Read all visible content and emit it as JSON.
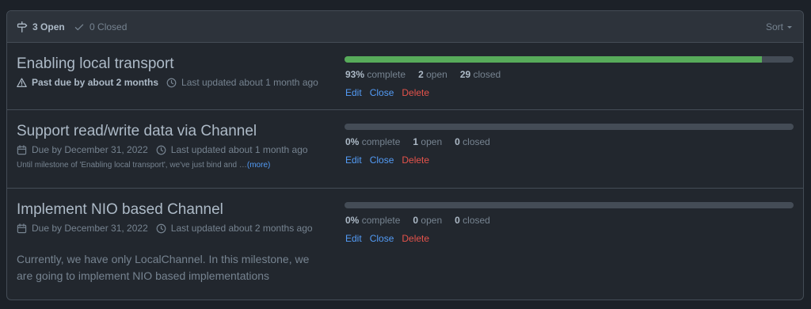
{
  "header": {
    "open_count": "3",
    "open_word": "Open",
    "closed_count": "0",
    "closed_word": "Closed",
    "sort_label": "Sort",
    "icons": {
      "open": "milestone-icon",
      "closed": "check-icon",
      "sort": "triangle-down-icon"
    }
  },
  "colors": {
    "progress_fill": "#57ab5a",
    "link": "#539bf5",
    "danger": "#e5534b"
  },
  "milestones": [
    {
      "title": "Enabling local transport",
      "due_text": "Past due by about 2 months",
      "due_icon": "alert-icon",
      "updated_text": "Last updated about 1 month ago",
      "progress": 0.93,
      "percent": "93%",
      "complete_word": "complete",
      "open_count": "2",
      "open_word": "open",
      "closed_count": "29",
      "closed_word": "closed",
      "actions": {
        "edit": "Edit",
        "close": "Close",
        "delete": "Delete"
      }
    },
    {
      "title": "Support read/write data via Channel",
      "due_text": "Due by December 31, 2022",
      "due_icon": "calendar-icon",
      "updated_text": "Last updated about 1 month ago",
      "description": "Until milestone of 'Enabling local transport', we've just bind and …",
      "more_label": "(more)",
      "progress": 0,
      "percent": "0%",
      "complete_word": "complete",
      "open_count": "1",
      "open_word": "open",
      "closed_count": "0",
      "closed_word": "closed",
      "actions": {
        "edit": "Edit",
        "close": "Close",
        "delete": "Delete"
      }
    },
    {
      "title": "Implement NIO based Channel",
      "due_text": "Due by December 31, 2022",
      "due_icon": "calendar-icon",
      "updated_text": "Last updated about 2 months ago",
      "description": "Currently, we have only LocalChannel. In this milestone, we are going to implement NIO based implementations",
      "progress": 0,
      "percent": "0%",
      "complete_word": "complete",
      "open_count": "0",
      "open_word": "open",
      "closed_count": "0",
      "closed_word": "closed",
      "actions": {
        "edit": "Edit",
        "close": "Close",
        "delete": "Delete"
      }
    }
  ]
}
